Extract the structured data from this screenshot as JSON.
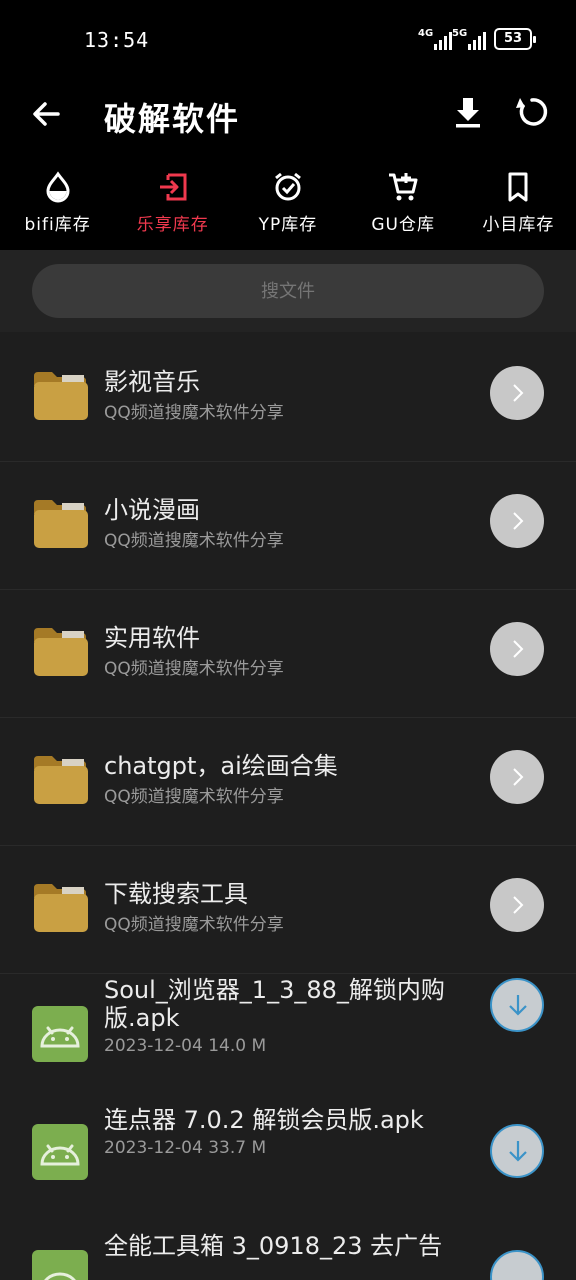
{
  "status": {
    "time": "13:54",
    "net1": "4G",
    "net2": "5G",
    "battery": "53"
  },
  "header": {
    "title": "破解软件"
  },
  "tabs": [
    {
      "label": "bifi库存",
      "icon": "water-drop-icon",
      "active": false
    },
    {
      "label": "乐享库存",
      "icon": "login-icon",
      "active": true
    },
    {
      "label": "YP库存",
      "icon": "alarm-check-icon",
      "active": false
    },
    {
      "label": "GU仓库",
      "icon": "cart-add-icon",
      "active": false
    },
    {
      "label": "小目库存",
      "icon": "bookmark-icon",
      "active": false
    }
  ],
  "search": {
    "placeholder": "搜文件"
  },
  "folders": [
    {
      "name": "影视音乐",
      "sub": "QQ频道搜魔术软件分享"
    },
    {
      "name": "小说漫画",
      "sub": "QQ频道搜魔术软件分享"
    },
    {
      "name": "实用软件",
      "sub": "QQ频道搜魔术软件分享"
    },
    {
      "name": "chatgpt，ai绘画合集",
      "sub": "QQ频道搜魔术软件分享"
    },
    {
      "name": "下载搜索工具",
      "sub": "QQ频道搜魔术软件分享"
    }
  ],
  "files": [
    {
      "name": "Soul_浏览器_1_3_88_解锁内购版.apk",
      "meta": "2023-12-04 14.0 M"
    },
    {
      "name": "连点器 7.0.2 解锁会员版.apk",
      "meta": "2023-12-04 33.7 M"
    },
    {
      "name": "全能工具箱 3_0918_23 去广告",
      "meta": ""
    }
  ],
  "colors": {
    "accent": "#f0394e",
    "folder": "#c9a043",
    "apk": "#7cae4f",
    "download_ring": "#3b93c8"
  }
}
